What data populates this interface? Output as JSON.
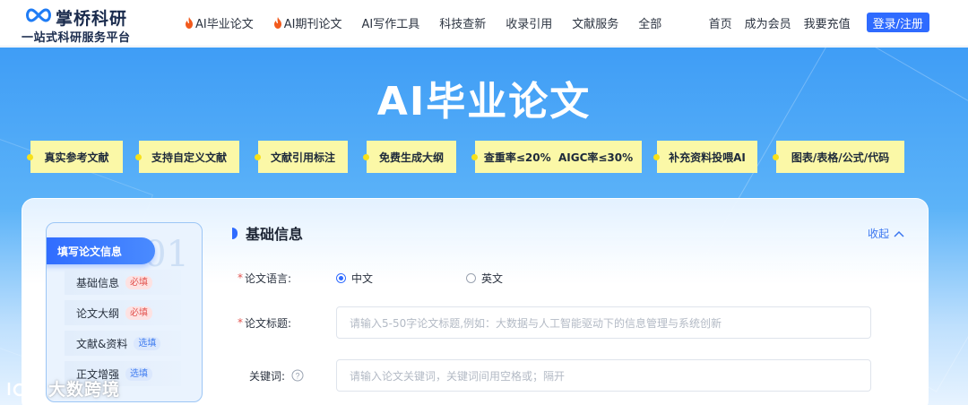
{
  "brand": {
    "name": "掌桥科研",
    "slogan": "一站式科研服务平台",
    "accent_color": "#2f6bff"
  },
  "nav": {
    "items": [
      {
        "label": "AI毕业论文",
        "icon": "fire-icon"
      },
      {
        "label": "AI期刊论文",
        "icon": "fire-icon"
      },
      {
        "label": "AI写作工具"
      },
      {
        "label": "科技查新"
      },
      {
        "label": "收录引用"
      },
      {
        "label": "文献服务"
      },
      {
        "label": "全部"
      }
    ],
    "right": {
      "home": "首页",
      "member": "成为会员",
      "recharge": "我要充值",
      "login": "登录/注册"
    }
  },
  "hero": {
    "title": "AI毕业论文",
    "features": [
      "真实参考文献",
      "支持自定义文献",
      "文献引用标注",
      "免费生成大纲",
      "查重率≤20%  AIGC率≤30%",
      "补充资料投喂AI",
      "图表/表格/公式/代码"
    ]
  },
  "sidebar": {
    "step_number": "01",
    "header": "填写论文信息",
    "items": [
      {
        "label": "基础信息",
        "badge": "必填",
        "required": true
      },
      {
        "label": "论文大纲",
        "badge": "必填",
        "required": true
      },
      {
        "label": "文献&资料",
        "badge": "选填",
        "required": false
      },
      {
        "label": "正文增强",
        "badge": "选填",
        "required": false
      }
    ]
  },
  "form": {
    "section_title": "基础信息",
    "collapse_label": "收起",
    "language": {
      "label": "论文语言:",
      "options": [
        "中文",
        "英文"
      ],
      "selected": "中文"
    },
    "title": {
      "label": "论文标题:",
      "placeholder": "请输入5-50字论文标题,例如：大数据与人工智能驱动下的信息管理与系统创新"
    },
    "keywords": {
      "label": "关键词:",
      "placeholder": "请输入论文关键词，关键词间用空格或；隔开"
    }
  },
  "watermark": {
    "text": "大数跨境"
  }
}
